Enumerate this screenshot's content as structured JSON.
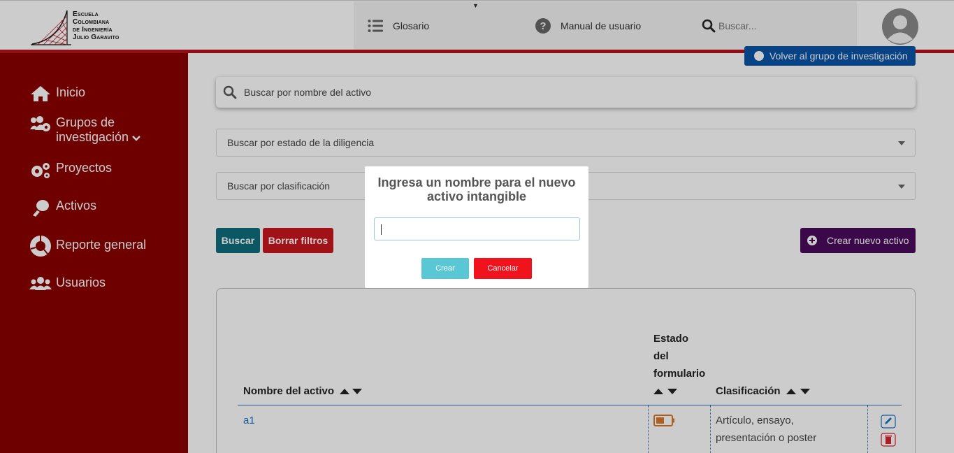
{
  "header": {
    "logo_lines": [
      "Escuela",
      "Colombiana",
      "de Ingeniería",
      "Julio Garavito"
    ],
    "nav": {
      "glosario": "Glosario",
      "manual": "Manual de usuario",
      "search_placeholder": "Buscar..."
    },
    "icons": [
      "list-icon",
      "question-circle-icon",
      "search-icon",
      "user-avatar-icon"
    ]
  },
  "sidebar": {
    "items": [
      {
        "label": "Inicio",
        "icon": "home-icon"
      },
      {
        "label": "Grupos de investigación",
        "label_line1": "Grupos de",
        "label_line2": "investigación",
        "icon": "users-cog-icon"
      },
      {
        "label": "Proyectos",
        "icon": "cogs-icon"
      },
      {
        "label": "Activos",
        "icon": "hand-icon"
      },
      {
        "label": "Reporte general",
        "icon": "pie-chart-icon"
      },
      {
        "label": "Usuarios",
        "icon": "users-icon"
      }
    ]
  },
  "main": {
    "volver_button": "Volver al grupo de investigación",
    "search_placeholder": "Buscar por nombre del activo",
    "filter_estado": "Buscar por estado de la diligencia",
    "filter_clasificacion": "Buscar por clasificación",
    "buscar_button": "Buscar",
    "borrar_button": "Borrar filtros",
    "crear_button": "Crear nuevo activo",
    "table": {
      "headers": {
        "nombre": "Nombre del activo",
        "estado_line1": "Estado",
        "estado_line2": "del",
        "estado_line3": "formulario",
        "clasificacion": "Clasificación"
      },
      "rows": [
        {
          "nombre": "a1",
          "estado_icon": "battery-low-icon",
          "clasificacion": "Artículo, ensayo, presentación o poster"
        }
      ]
    }
  },
  "modal": {
    "title": "Ingresa un nombre para el nuevo activo intangible",
    "input_value": "",
    "crear": "Crear",
    "cancelar": "Cancelar"
  },
  "colors": {
    "sidebar": "#8b0000",
    "accent_red": "#b5121b",
    "buscar": "#0e6e7d",
    "borrar": "#c8161f",
    "crear_activo": "#4a0a5c",
    "modal_crear": "#5ac8d4",
    "modal_cancel": "#f0131e"
  }
}
